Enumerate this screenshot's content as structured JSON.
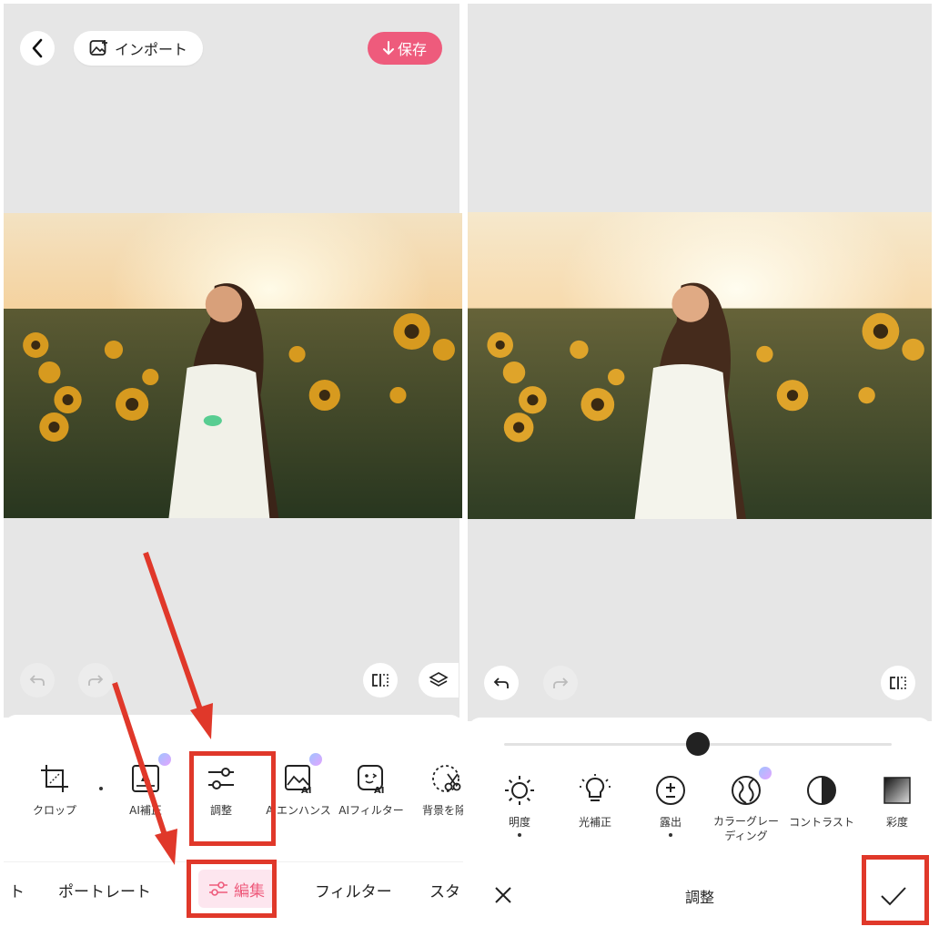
{
  "left": {
    "header": {
      "import_label": "インポート",
      "save_label": "保存"
    },
    "tools": [
      {
        "label": "クロップ",
        "icon": "crop-icon"
      },
      {
        "label": "AI補正",
        "icon": "ai-enhance-portrait-icon"
      },
      {
        "label": "調整",
        "icon": "sliders-icon"
      },
      {
        "label": "AIエンハンス",
        "icon": "ai-image-icon"
      },
      {
        "label": "AIフィルター",
        "icon": "ai-face-icon"
      },
      {
        "label": "背景を除",
        "icon": "scissors-icon"
      }
    ],
    "tabs": [
      {
        "label": "ト"
      },
      {
        "label": "ポートレート"
      },
      {
        "label": "編集",
        "active": true
      },
      {
        "label": "フィルター"
      },
      {
        "label": "スタ"
      }
    ]
  },
  "right": {
    "slider_value": 0.5,
    "adjust_tools": [
      {
        "label": "明度",
        "icon": "sun-icon",
        "dot": true
      },
      {
        "label": "光補正",
        "icon": "bulb-icon",
        "dot": false
      },
      {
        "label": "露出",
        "icon": "exposure-icon",
        "dot": true
      },
      {
        "label": "カラーグレーディング",
        "line1": "カラーグレー",
        "line2": "ディング",
        "icon": "color-grading-icon",
        "dot": false
      },
      {
        "label": "コントラスト",
        "icon": "contrast-icon",
        "dot": false
      },
      {
        "label": "彩度",
        "icon": "saturation-icon",
        "dot": false
      }
    ],
    "bottom_title": "調整"
  },
  "colors": {
    "accent": "#ee5b7c",
    "annotation_red": "#e0382a",
    "canvas_grey": "#e6e6e6"
  }
}
